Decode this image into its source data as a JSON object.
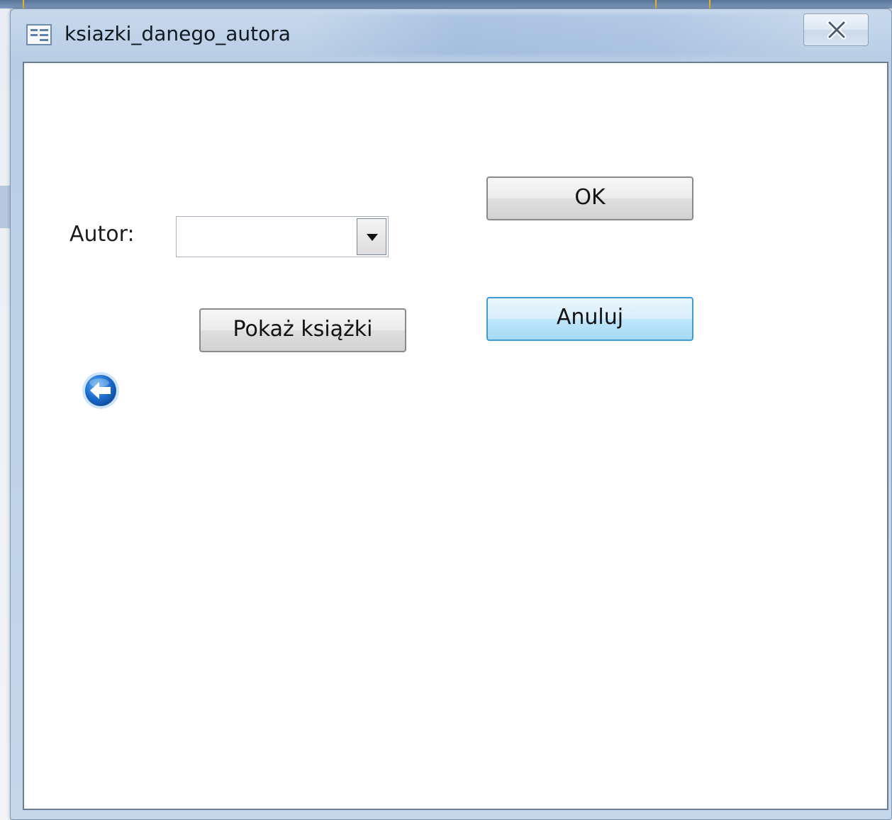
{
  "window": {
    "title": "ksiazki_danego_autora",
    "icon": "form-icon",
    "close_icon": "close-icon"
  },
  "form": {
    "author_label": "Autor:",
    "author_combo": {
      "value": "",
      "dropdown_icon": "chevron-down-icon"
    },
    "ok_button": "OK",
    "cancel_button": "Anuluj",
    "show_books_button": "Pokaż książki",
    "back_icon": "back-arrow-icon"
  },
  "colors": {
    "title_bar": "#c9d9ec",
    "focus_border": "#3f9ad6",
    "back_icon": "#1e6fd0"
  }
}
